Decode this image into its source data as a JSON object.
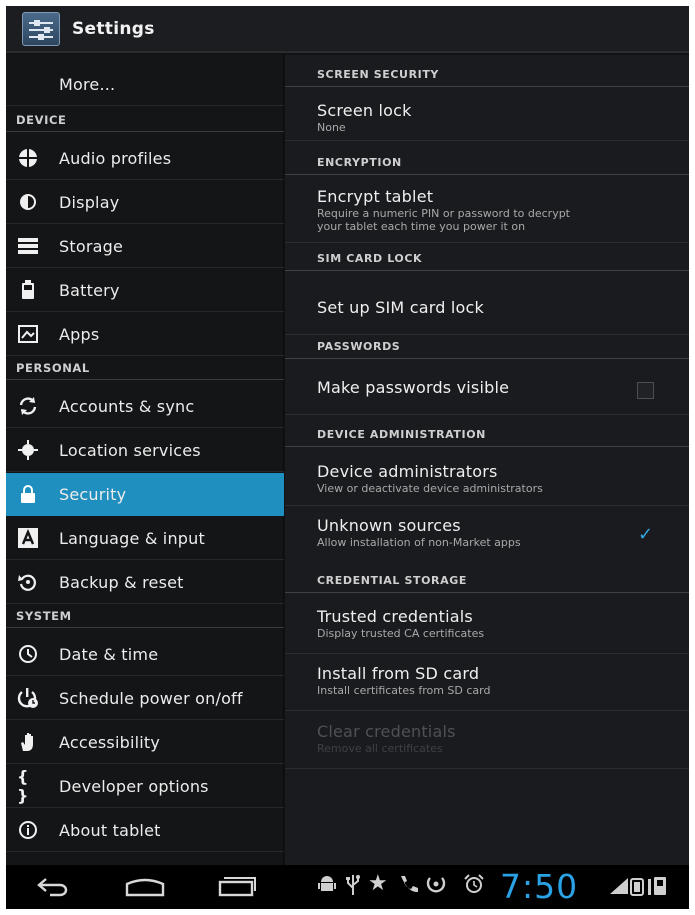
{
  "app": {
    "title": "Settings"
  },
  "sidebar": {
    "more": "More...",
    "sections": [
      {
        "header": "DEVICE",
        "items": [
          {
            "label": "Audio profiles",
            "icon": "audio-profiles-icon"
          },
          {
            "label": "Display",
            "icon": "display-icon"
          },
          {
            "label": "Storage",
            "icon": "storage-icon"
          },
          {
            "label": "Battery",
            "icon": "battery-icon"
          },
          {
            "label": "Apps",
            "icon": "apps-icon"
          }
        ]
      },
      {
        "header": "PERSONAL",
        "items": [
          {
            "label": "Accounts & sync",
            "icon": "sync-icon"
          },
          {
            "label": "Location services",
            "icon": "location-icon"
          },
          {
            "label": "Security",
            "icon": "lock-icon",
            "selected": true
          },
          {
            "label": "Language & input",
            "icon": "keyboard-icon"
          },
          {
            "label": "Backup & reset",
            "icon": "backup-icon"
          }
        ]
      },
      {
        "header": "SYSTEM",
        "items": [
          {
            "label": "Date & time",
            "icon": "clock-icon"
          },
          {
            "label": "Schedule power on/off",
            "icon": "schedule-power-icon"
          },
          {
            "label": "Accessibility",
            "icon": "hand-icon"
          },
          {
            "label": "Developer options",
            "icon": "braces-icon"
          },
          {
            "label": "About tablet",
            "icon": "info-icon"
          }
        ]
      }
    ]
  },
  "security": {
    "screen_security": {
      "header": "SCREEN SECURITY",
      "screen_lock": {
        "title": "Screen lock",
        "summary": "None"
      }
    },
    "encryption": {
      "header": "ENCRYPTION",
      "encrypt_tablet": {
        "title": "Encrypt tablet",
        "summary_line1": "Require a numeric PIN or password to decrypt",
        "summary_line2": "your tablet each time you power it on"
      }
    },
    "sim_card_lock": {
      "header": "SIM CARD LOCK",
      "setup": {
        "title": "Set up SIM card lock"
      }
    },
    "passwords": {
      "header": "PASSWORDS",
      "visible": {
        "title": "Make passwords visible",
        "checked": false
      }
    },
    "device_administration": {
      "header": "DEVICE ADMINISTRATION",
      "admins": {
        "title": "Device administrators",
        "summary": "View or deactivate device administrators"
      },
      "unknown_sources": {
        "title": "Unknown sources",
        "summary": "Allow installation of non-Market apps",
        "checked": true
      }
    },
    "credential_storage": {
      "header": "CREDENTIAL STORAGE",
      "trusted": {
        "title": "Trusted credentials",
        "summary": "Display trusted CA certificates"
      },
      "install": {
        "title": "Install from SD card",
        "summary": "Install certificates from SD card"
      },
      "clear": {
        "title": "Clear credentials",
        "summary": "Remove all certificates",
        "enabled": false
      }
    }
  },
  "navbar": {
    "buttons": [
      "back-icon",
      "home-icon",
      "recent-apps-icon"
    ],
    "status_icons": [
      "android-debug-icon",
      "usb-icon",
      "star-icon",
      "phone-icon",
      "alarm-icon",
      "signal-icon",
      "battery-status-icon"
    ],
    "time": "7:50"
  },
  "colors": {
    "accent": "#1f8fbf",
    "clock": "#2aa3e6",
    "check": "#35a8e0"
  }
}
